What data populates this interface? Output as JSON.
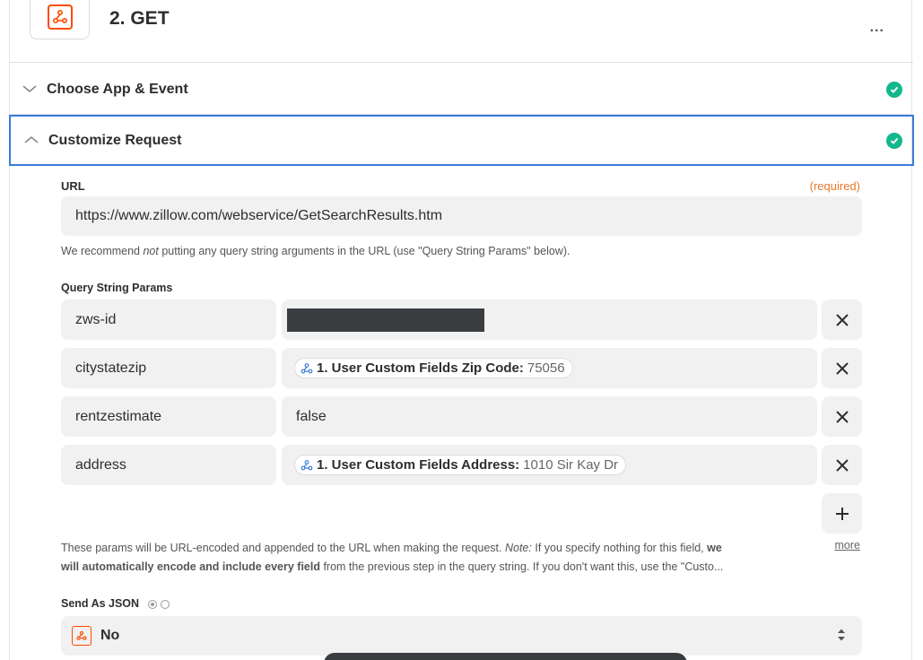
{
  "step": {
    "title": "2. GET",
    "menu": "..."
  },
  "sections": {
    "choose": {
      "label": "Choose App & Event"
    },
    "customize": {
      "label": "Customize Request"
    }
  },
  "url_field": {
    "label": "URL",
    "required": "(required)",
    "value": "https://www.zillow.com/webservice/GetSearchResults.htm",
    "helper_pre": "We recommend ",
    "helper_em": "not",
    "helper_post": " putting any query string arguments in the URL (use \"Query String Params\" below)."
  },
  "query_params": {
    "label": "Query String Params",
    "rows": [
      {
        "key": "zws-id",
        "value": ""
      },
      {
        "key": "citystatezip",
        "pill_label": "1. User Custom Fields Zip Code:",
        "pill_value": "75056"
      },
      {
        "key": "rentzestimate",
        "value": "false"
      },
      {
        "key": "address",
        "pill_label": "1. User Custom Fields Address:",
        "pill_value": "1010 Sir Kay Dr"
      }
    ],
    "add_symbol": "+",
    "remove_symbol": "✕"
  },
  "params_helper": {
    "line1_pre": "These params will be URL-encoded and appended to the URL when making the request. ",
    "line1_note": "Note:",
    "line1_mid": " If you specify nothing for this field, ",
    "line1_bold": "we",
    "line2_bold": "will automatically encode and include every field",
    "line2_post": " from the previous step in the query string. If you don't want this, use the \"Custo...",
    "more": "more"
  },
  "send_as_json": {
    "label": "Send As JSON",
    "selected": "No"
  },
  "colors": {
    "accent": "#ff4a00",
    "success": "#13b78d",
    "focus_border": "#3c7bd8",
    "required": "#e8782a"
  }
}
